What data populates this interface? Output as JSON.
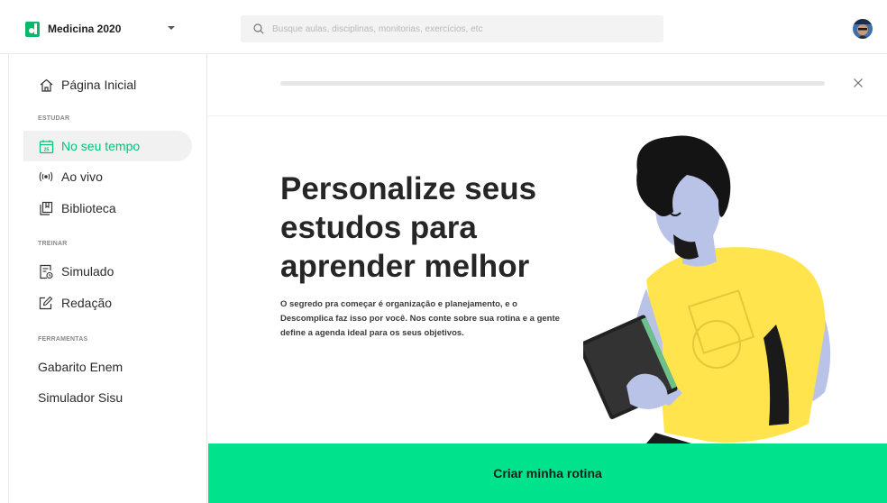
{
  "header": {
    "course_name": "Medicina 2020",
    "search_placeholder": "Busque aulas, disciplinas, monitorias, exercícios, etc"
  },
  "sidebar": {
    "home": "Página Inicial",
    "sections": {
      "estudar": "ESTUDAR",
      "treinar": "TREINAR",
      "ferramentas": "FERRAMENTAS"
    },
    "items": {
      "no_seu_tempo": "No seu tempo",
      "ao_vivo": "Ao vivo",
      "biblioteca": "Biblioteca",
      "simulado": "Simulado",
      "redacao": "Redação",
      "gabarito_enem": "Gabarito Enem",
      "simulador_sisu": "Simulador Sisu"
    },
    "calendar_day": "25"
  },
  "main": {
    "progress": 0,
    "headline": "Personalize seus estudos para aprender melhor",
    "description": "O segredo pra começar é organização e planejamento, e o Descomplica faz isso por você. Nos conte sobre sua rotina e a gente define a agenda ideal para os seus objetivos.",
    "cta": "Criar minha rotina"
  },
  "colors": {
    "accent": "#00e28b",
    "active_text": "#00c57a",
    "brand": "#0bb76b"
  }
}
